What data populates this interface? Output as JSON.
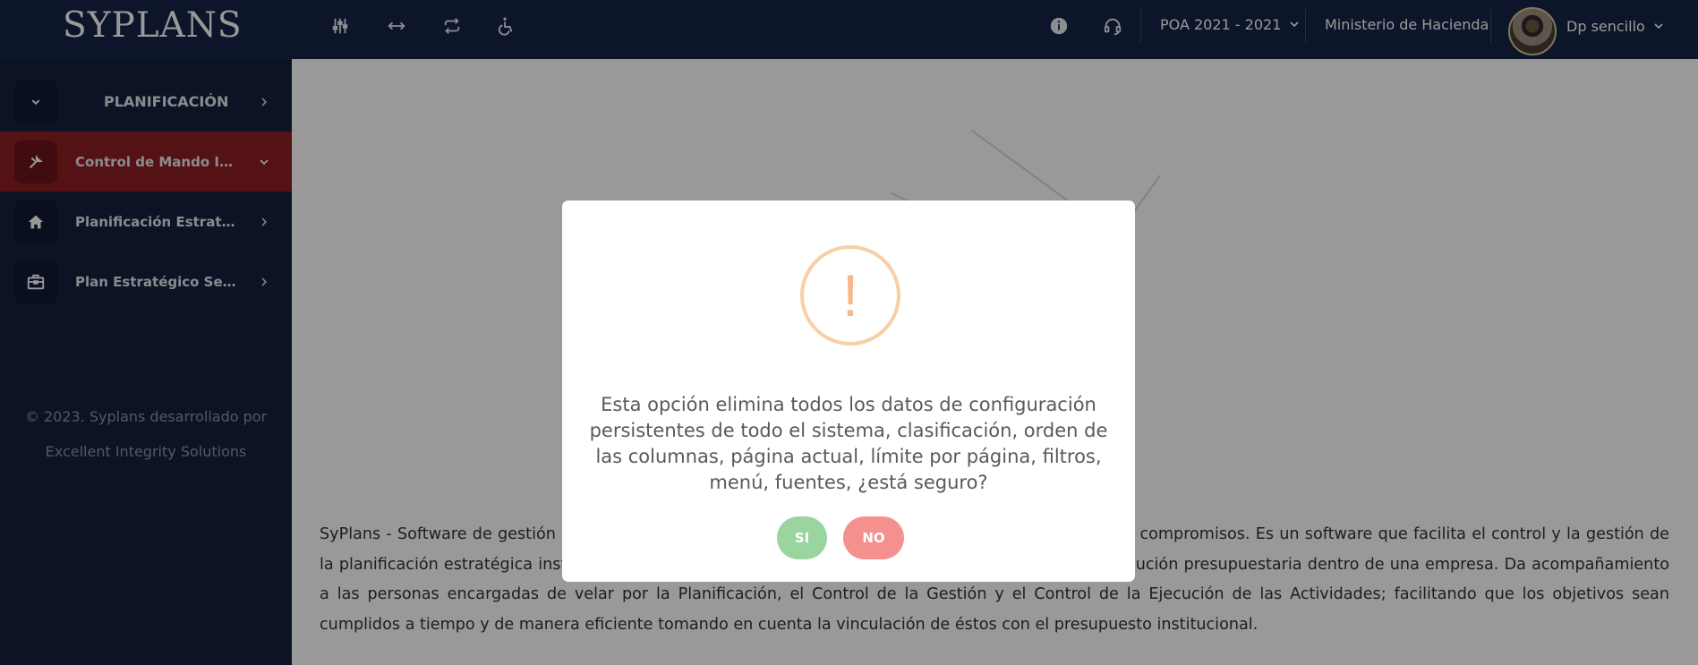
{
  "header": {
    "brand": "SYPLANS",
    "toolbar_icons": [
      "sliders-icon",
      "expand-width-icon",
      "repeat-icon",
      "accessibility-icon"
    ],
    "right": {
      "info_icon": "info-icon",
      "support_icon": "headset-icon",
      "poa_selector": "POA 2021 - 2021",
      "institution": "Ministerio de Hacienda",
      "user_name": "Dp sencillo"
    }
  },
  "sidebar": {
    "items": [
      {
        "label": "PLANIFICACIÓN",
        "icon": "chevron-down-icon"
      },
      {
        "label": "Control de Mando Integ...",
        "icon": "tools-icon"
      },
      {
        "label": "Planificación Estratégic...",
        "icon": "home-icon"
      },
      {
        "label": "Plan Estratégico Sectori...",
        "icon": "briefcase-icon"
      }
    ],
    "footer_line1": "© 2023. Syplans desarrollado por",
    "footer_line2": "Excellent Integrity Solutions"
  },
  "main": {
    "description": "SyPlans - Software de gestión de la planificación estratégica y operativa, seguimiento y evaluación de compromisos. Es un software que facilita el control y la gestión de la planificación estratégica institucional, la programación operativa anual y la programación de la ejecución presupuestaria dentro de una empresa. Da acompañamiento a las personas encargadas de velar por la Planificación, el Control de la Gestión y el Control de la Ejecución de las Actividades; facilitando que los objetivos sean cumplidos a tiempo y de manera eficiente tomando en cuenta la vinculación de éstos con el presupuesto institucional."
  },
  "dialog": {
    "icon": "warning-icon",
    "message": "Esta opción elimina todos los datos de configuración persistentes de todo el sistema, clasificación, orden de las columnas, página actual, límite por página, filtros, menú, fuentes, ¿está seguro?",
    "confirm_label": "SI",
    "cancel_label": "NO"
  },
  "colors": {
    "topbar": "#162447",
    "sidebar": "#13203d",
    "active_item": "#8e1f24",
    "confirm": "#9ad49e",
    "cancel": "#f4908d",
    "warning": "#f8cfa6"
  }
}
